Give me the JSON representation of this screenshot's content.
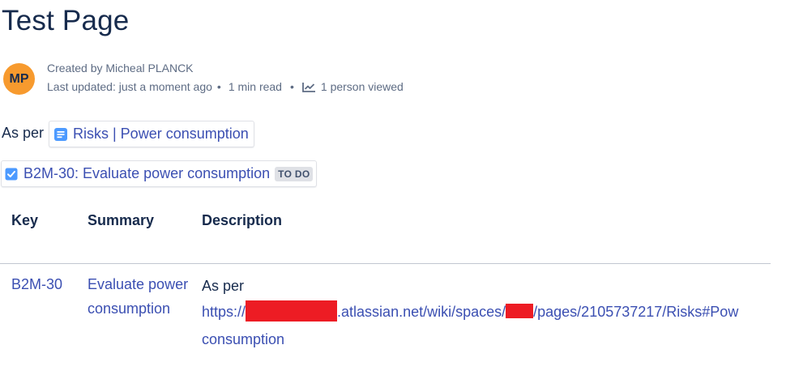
{
  "page": {
    "title": "Test Page"
  },
  "byline": {
    "avatar_initials": "MP",
    "avatar_color": "#f79a2e",
    "created": "Created by Micheal PLANCK",
    "last_updated": "Last updated: just a moment ago",
    "separator": "•",
    "read_time": "1 min read",
    "viewed": "1 person viewed",
    "viewed_icon": "analytics-chart-icon"
  },
  "content": {
    "as_per": "As per",
    "page_link": {
      "icon": "page-document-icon",
      "label": "Risks | Power consumption"
    },
    "issue": {
      "icon": "task-checkbox-icon",
      "label": "B2M-30: Evaluate power consumption",
      "status": "TO DO"
    }
  },
  "table": {
    "headers": [
      "Key",
      "Summary",
      "Description"
    ],
    "rows": [
      {
        "key": "B2M-30",
        "summary": "Evaluate power consumption",
        "description_prefix": "As per",
        "link_start": "https://",
        "link_mid": ".atlassian.net/wiki/spaces/",
        "link_end": "/pages/2105737217/Risks#Pow",
        "link_wrap": "consumption"
      }
    ]
  },
  "colors": {
    "text": "#172b4d",
    "subtle": "#5e6c84",
    "link": "#3b4fb2",
    "redaction": "#ed1c24",
    "icon_blue": "#4c9aff"
  }
}
